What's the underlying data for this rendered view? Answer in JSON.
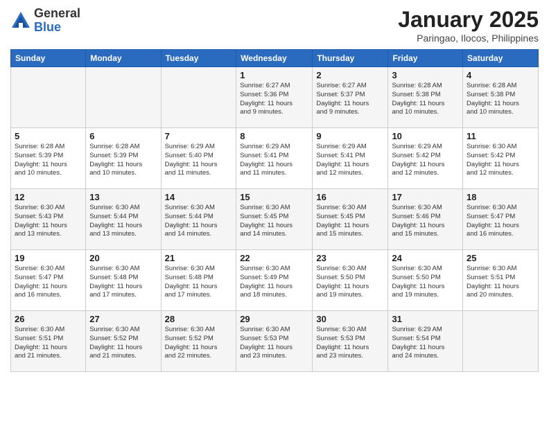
{
  "logo": {
    "general": "General",
    "blue": "Blue"
  },
  "title": "January 2025",
  "subtitle": "Paringao, Ilocos, Philippines",
  "weekdays": [
    "Sunday",
    "Monday",
    "Tuesday",
    "Wednesday",
    "Thursday",
    "Friday",
    "Saturday"
  ],
  "weeks": [
    [
      {
        "day": "",
        "info": ""
      },
      {
        "day": "",
        "info": ""
      },
      {
        "day": "",
        "info": ""
      },
      {
        "day": "1",
        "info": "Sunrise: 6:27 AM\nSunset: 5:36 PM\nDaylight: 11 hours\nand 9 minutes."
      },
      {
        "day": "2",
        "info": "Sunrise: 6:27 AM\nSunset: 5:37 PM\nDaylight: 11 hours\nand 9 minutes."
      },
      {
        "day": "3",
        "info": "Sunrise: 6:28 AM\nSunset: 5:38 PM\nDaylight: 11 hours\nand 10 minutes."
      },
      {
        "day": "4",
        "info": "Sunrise: 6:28 AM\nSunset: 5:38 PM\nDaylight: 11 hours\nand 10 minutes."
      }
    ],
    [
      {
        "day": "5",
        "info": "Sunrise: 6:28 AM\nSunset: 5:39 PM\nDaylight: 11 hours\nand 10 minutes."
      },
      {
        "day": "6",
        "info": "Sunrise: 6:28 AM\nSunset: 5:39 PM\nDaylight: 11 hours\nand 10 minutes."
      },
      {
        "day": "7",
        "info": "Sunrise: 6:29 AM\nSunset: 5:40 PM\nDaylight: 11 hours\nand 11 minutes."
      },
      {
        "day": "8",
        "info": "Sunrise: 6:29 AM\nSunset: 5:41 PM\nDaylight: 11 hours\nand 11 minutes."
      },
      {
        "day": "9",
        "info": "Sunrise: 6:29 AM\nSunset: 5:41 PM\nDaylight: 11 hours\nand 12 minutes."
      },
      {
        "day": "10",
        "info": "Sunrise: 6:29 AM\nSunset: 5:42 PM\nDaylight: 11 hours\nand 12 minutes."
      },
      {
        "day": "11",
        "info": "Sunrise: 6:30 AM\nSunset: 5:42 PM\nDaylight: 11 hours\nand 12 minutes."
      }
    ],
    [
      {
        "day": "12",
        "info": "Sunrise: 6:30 AM\nSunset: 5:43 PM\nDaylight: 11 hours\nand 13 minutes."
      },
      {
        "day": "13",
        "info": "Sunrise: 6:30 AM\nSunset: 5:44 PM\nDaylight: 11 hours\nand 13 minutes."
      },
      {
        "day": "14",
        "info": "Sunrise: 6:30 AM\nSunset: 5:44 PM\nDaylight: 11 hours\nand 14 minutes."
      },
      {
        "day": "15",
        "info": "Sunrise: 6:30 AM\nSunset: 5:45 PM\nDaylight: 11 hours\nand 14 minutes."
      },
      {
        "day": "16",
        "info": "Sunrise: 6:30 AM\nSunset: 5:45 PM\nDaylight: 11 hours\nand 15 minutes."
      },
      {
        "day": "17",
        "info": "Sunrise: 6:30 AM\nSunset: 5:46 PM\nDaylight: 11 hours\nand 15 minutes."
      },
      {
        "day": "18",
        "info": "Sunrise: 6:30 AM\nSunset: 5:47 PM\nDaylight: 11 hours\nand 16 minutes."
      }
    ],
    [
      {
        "day": "19",
        "info": "Sunrise: 6:30 AM\nSunset: 5:47 PM\nDaylight: 11 hours\nand 16 minutes."
      },
      {
        "day": "20",
        "info": "Sunrise: 6:30 AM\nSunset: 5:48 PM\nDaylight: 11 hours\nand 17 minutes."
      },
      {
        "day": "21",
        "info": "Sunrise: 6:30 AM\nSunset: 5:48 PM\nDaylight: 11 hours\nand 17 minutes."
      },
      {
        "day": "22",
        "info": "Sunrise: 6:30 AM\nSunset: 5:49 PM\nDaylight: 11 hours\nand 18 minutes."
      },
      {
        "day": "23",
        "info": "Sunrise: 6:30 AM\nSunset: 5:50 PM\nDaylight: 11 hours\nand 19 minutes."
      },
      {
        "day": "24",
        "info": "Sunrise: 6:30 AM\nSunset: 5:50 PM\nDaylight: 11 hours\nand 19 minutes."
      },
      {
        "day": "25",
        "info": "Sunrise: 6:30 AM\nSunset: 5:51 PM\nDaylight: 11 hours\nand 20 minutes."
      }
    ],
    [
      {
        "day": "26",
        "info": "Sunrise: 6:30 AM\nSunset: 5:51 PM\nDaylight: 11 hours\nand 21 minutes."
      },
      {
        "day": "27",
        "info": "Sunrise: 6:30 AM\nSunset: 5:52 PM\nDaylight: 11 hours\nand 21 minutes."
      },
      {
        "day": "28",
        "info": "Sunrise: 6:30 AM\nSunset: 5:52 PM\nDaylight: 11 hours\nand 22 minutes."
      },
      {
        "day": "29",
        "info": "Sunrise: 6:30 AM\nSunset: 5:53 PM\nDaylight: 11 hours\nand 23 minutes."
      },
      {
        "day": "30",
        "info": "Sunrise: 6:30 AM\nSunset: 5:53 PM\nDaylight: 11 hours\nand 23 minutes."
      },
      {
        "day": "31",
        "info": "Sunrise: 6:29 AM\nSunset: 5:54 PM\nDaylight: 11 hours\nand 24 minutes."
      },
      {
        "day": "",
        "info": ""
      }
    ]
  ]
}
